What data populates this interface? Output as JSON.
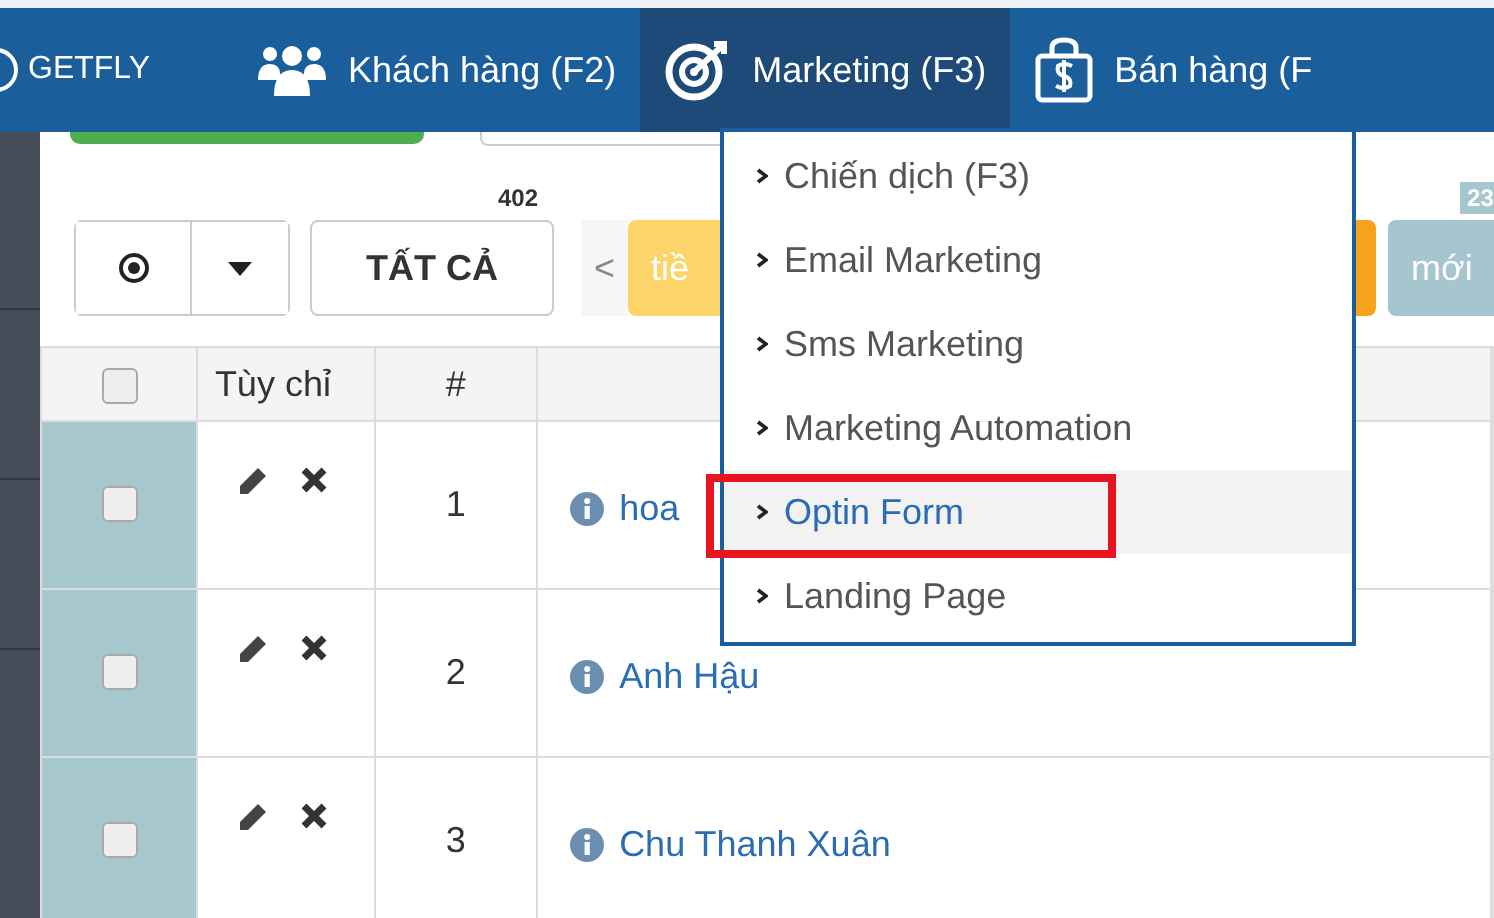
{
  "nav": {
    "brand": "GETFLY",
    "items": [
      {
        "label": "Khách hàng (F2)",
        "kind": "people",
        "selected": false
      },
      {
        "label": "Marketing (F3)",
        "kind": "target",
        "selected": true
      },
      {
        "label": "Bán hàng (F",
        "kind": "bag",
        "selected": false
      }
    ]
  },
  "toolbar": {
    "radio_selected": true,
    "count": "402",
    "all_button": "TẤT CẢ",
    "prev": "<",
    "tabs": [
      {
        "label": "tiề",
        "color": "#fdd469"
      },
      {
        "color": "#f7a21b"
      },
      {
        "label": "mới",
        "color": "#a5c6cf",
        "count": "23"
      }
    ]
  },
  "table": {
    "columns": [
      "Tùy chỉ",
      "#"
    ],
    "header_checked": false,
    "rows": [
      {
        "number": "1",
        "name": "hoa",
        "checked": false
      },
      {
        "number": "2",
        "name": "Anh Hậu",
        "checked": false
      },
      {
        "number": "3",
        "name": "Chu Thanh Xuân",
        "checked": false
      }
    ]
  },
  "menu": {
    "items": [
      {
        "label": "Chiến dịch (F3)",
        "selected": false,
        "highlighted": false
      },
      {
        "label": "Email Marketing",
        "selected": false,
        "highlighted": false
      },
      {
        "label": "Sms Marketing",
        "selected": false,
        "highlighted": false
      },
      {
        "label": "Marketing Automation",
        "selected": false,
        "highlighted": false
      },
      {
        "label": "Optin Form",
        "selected": true,
        "highlighted": true
      },
      {
        "label": "Landing Page",
        "selected": false,
        "highlighted": false
      }
    ]
  }
}
